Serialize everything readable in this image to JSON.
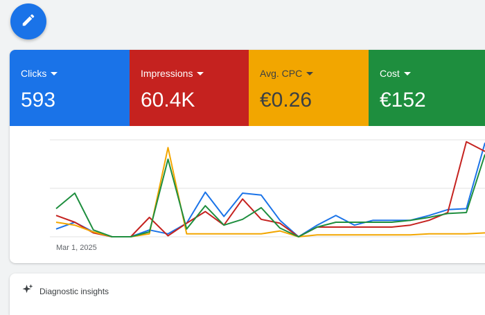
{
  "fab": {
    "icon": "pencil-icon"
  },
  "metrics": [
    {
      "label": "Clicks",
      "value": "593",
      "color": "#1a73e8"
    },
    {
      "label": "Impressions",
      "value": "60.4K",
      "color": "#c5221f"
    },
    {
      "label": "Avg. CPC",
      "value": "€0.26",
      "color": "#f2a600"
    },
    {
      "label": "Cost",
      "value": "€152",
      "color": "#1e8e3e"
    }
  ],
  "chart_data": {
    "type": "line",
    "x_start_label": "Mar 1, 2025",
    "grid": true,
    "ylim": [
      0,
      100
    ],
    "series": [
      {
        "color": "#1a73e8",
        "values": [
          8,
          15,
          5,
          0,
          0,
          7,
          3,
          14,
          46,
          21,
          45,
          43,
          17,
          0,
          12,
          22,
          12,
          17,
          17,
          17,
          22,
          28,
          29,
          97
        ]
      },
      {
        "color": "#c5221f",
        "values": [
          22,
          15,
          4,
          0,
          0,
          20,
          1,
          14,
          26,
          12,
          39,
          18,
          14,
          0,
          10,
          10,
          10,
          10,
          10,
          12,
          17,
          25,
          98,
          88
        ]
      },
      {
        "color": "#f2a600",
        "values": [
          15,
          12,
          5,
          0,
          0,
          3,
          92,
          3,
          3,
          3,
          3,
          3,
          6,
          0,
          2,
          2,
          2,
          2,
          2,
          2,
          3,
          3,
          3,
          4
        ]
      },
      {
        "color": "#1e8e3e",
        "values": [
          29,
          45,
          7,
          0,
          0,
          5,
          80,
          8,
          32,
          12,
          18,
          30,
          9,
          0,
          10,
          15,
          15,
          15,
          15,
          17,
          20,
          24,
          25,
          85
        ]
      }
    ]
  },
  "insights": {
    "label": "Diagnostic insights",
    "icon": "sparkle-icon"
  }
}
